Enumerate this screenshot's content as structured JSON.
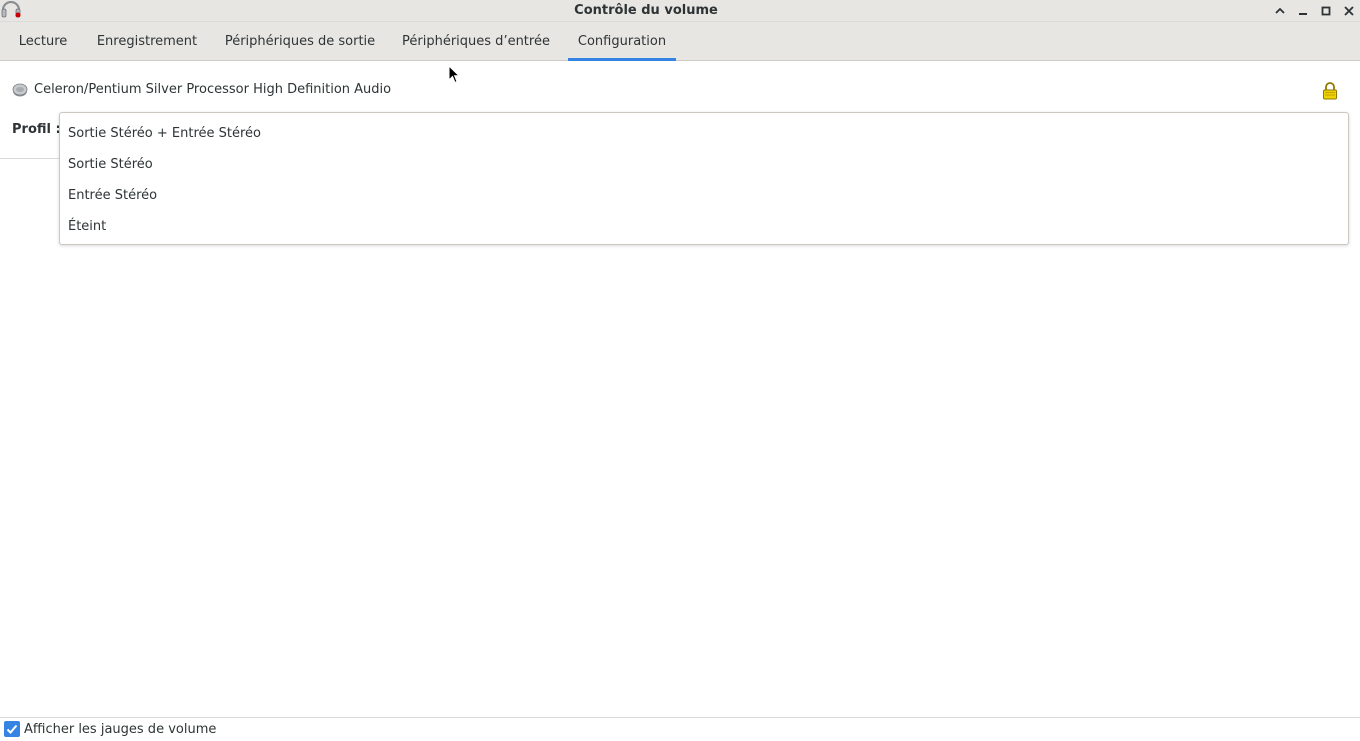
{
  "window": {
    "title": "Contrôle du volume",
    "controls": [
      "chevron-up-icon",
      "minimize-icon",
      "maximize-icon",
      "close-icon"
    ]
  },
  "tabs": [
    {
      "label": "Lecture",
      "active": false
    },
    {
      "label": "Enregistrement",
      "active": false
    },
    {
      "label": "Périphériques de sortie",
      "active": false
    },
    {
      "label": "Périphériques d’entrée",
      "active": false
    },
    {
      "label": "Configuration",
      "active": true
    }
  ],
  "card": {
    "name": "Celeron/Pentium Silver Processor High Definition Audio",
    "icon": "audio-card-icon",
    "lock_icon": "lock-icon"
  },
  "profile": {
    "label": "Profil :",
    "options": [
      "Sortie Stéréo + Entrée Stéréo",
      "Sortie Stéréo",
      "Entrée Stéréo",
      "Éteint"
    ]
  },
  "footer": {
    "show_meters_label": "Afficher les jauges de volume",
    "show_meters_checked": true
  },
  "colors": {
    "accent": "#3584e4",
    "titlebar_bg": "#e8e6e3",
    "lock": "#c4a000"
  }
}
